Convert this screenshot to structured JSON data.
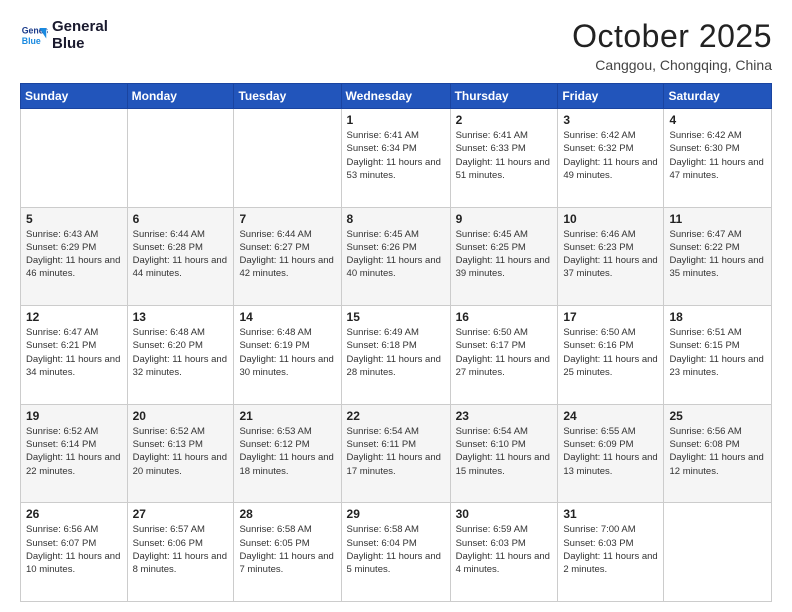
{
  "logo": {
    "line1": "General",
    "line2": "Blue"
  },
  "title": "October 2025",
  "subtitle": "Canggou, Chongqing, China",
  "days_of_week": [
    "Sunday",
    "Monday",
    "Tuesday",
    "Wednesday",
    "Thursday",
    "Friday",
    "Saturday"
  ],
  "weeks": [
    [
      {
        "day": "",
        "info": ""
      },
      {
        "day": "",
        "info": ""
      },
      {
        "day": "",
        "info": ""
      },
      {
        "day": "1",
        "info": "Sunrise: 6:41 AM\nSunset: 6:34 PM\nDaylight: 11 hours and 53 minutes."
      },
      {
        "day": "2",
        "info": "Sunrise: 6:41 AM\nSunset: 6:33 PM\nDaylight: 11 hours and 51 minutes."
      },
      {
        "day": "3",
        "info": "Sunrise: 6:42 AM\nSunset: 6:32 PM\nDaylight: 11 hours and 49 minutes."
      },
      {
        "day": "4",
        "info": "Sunrise: 6:42 AM\nSunset: 6:30 PM\nDaylight: 11 hours and 47 minutes."
      }
    ],
    [
      {
        "day": "5",
        "info": "Sunrise: 6:43 AM\nSunset: 6:29 PM\nDaylight: 11 hours and 46 minutes."
      },
      {
        "day": "6",
        "info": "Sunrise: 6:44 AM\nSunset: 6:28 PM\nDaylight: 11 hours and 44 minutes."
      },
      {
        "day": "7",
        "info": "Sunrise: 6:44 AM\nSunset: 6:27 PM\nDaylight: 11 hours and 42 minutes."
      },
      {
        "day": "8",
        "info": "Sunrise: 6:45 AM\nSunset: 6:26 PM\nDaylight: 11 hours and 40 minutes."
      },
      {
        "day": "9",
        "info": "Sunrise: 6:45 AM\nSunset: 6:25 PM\nDaylight: 11 hours and 39 minutes."
      },
      {
        "day": "10",
        "info": "Sunrise: 6:46 AM\nSunset: 6:23 PM\nDaylight: 11 hours and 37 minutes."
      },
      {
        "day": "11",
        "info": "Sunrise: 6:47 AM\nSunset: 6:22 PM\nDaylight: 11 hours and 35 minutes."
      }
    ],
    [
      {
        "day": "12",
        "info": "Sunrise: 6:47 AM\nSunset: 6:21 PM\nDaylight: 11 hours and 34 minutes."
      },
      {
        "day": "13",
        "info": "Sunrise: 6:48 AM\nSunset: 6:20 PM\nDaylight: 11 hours and 32 minutes."
      },
      {
        "day": "14",
        "info": "Sunrise: 6:48 AM\nSunset: 6:19 PM\nDaylight: 11 hours and 30 minutes."
      },
      {
        "day": "15",
        "info": "Sunrise: 6:49 AM\nSunset: 6:18 PM\nDaylight: 11 hours and 28 minutes."
      },
      {
        "day": "16",
        "info": "Sunrise: 6:50 AM\nSunset: 6:17 PM\nDaylight: 11 hours and 27 minutes."
      },
      {
        "day": "17",
        "info": "Sunrise: 6:50 AM\nSunset: 6:16 PM\nDaylight: 11 hours and 25 minutes."
      },
      {
        "day": "18",
        "info": "Sunrise: 6:51 AM\nSunset: 6:15 PM\nDaylight: 11 hours and 23 minutes."
      }
    ],
    [
      {
        "day": "19",
        "info": "Sunrise: 6:52 AM\nSunset: 6:14 PM\nDaylight: 11 hours and 22 minutes."
      },
      {
        "day": "20",
        "info": "Sunrise: 6:52 AM\nSunset: 6:13 PM\nDaylight: 11 hours and 20 minutes."
      },
      {
        "day": "21",
        "info": "Sunrise: 6:53 AM\nSunset: 6:12 PM\nDaylight: 11 hours and 18 minutes."
      },
      {
        "day": "22",
        "info": "Sunrise: 6:54 AM\nSunset: 6:11 PM\nDaylight: 11 hours and 17 minutes."
      },
      {
        "day": "23",
        "info": "Sunrise: 6:54 AM\nSunset: 6:10 PM\nDaylight: 11 hours and 15 minutes."
      },
      {
        "day": "24",
        "info": "Sunrise: 6:55 AM\nSunset: 6:09 PM\nDaylight: 11 hours and 13 minutes."
      },
      {
        "day": "25",
        "info": "Sunrise: 6:56 AM\nSunset: 6:08 PM\nDaylight: 11 hours and 12 minutes."
      }
    ],
    [
      {
        "day": "26",
        "info": "Sunrise: 6:56 AM\nSunset: 6:07 PM\nDaylight: 11 hours and 10 minutes."
      },
      {
        "day": "27",
        "info": "Sunrise: 6:57 AM\nSunset: 6:06 PM\nDaylight: 11 hours and 8 minutes."
      },
      {
        "day": "28",
        "info": "Sunrise: 6:58 AM\nSunset: 6:05 PM\nDaylight: 11 hours and 7 minutes."
      },
      {
        "day": "29",
        "info": "Sunrise: 6:58 AM\nSunset: 6:04 PM\nDaylight: 11 hours and 5 minutes."
      },
      {
        "day": "30",
        "info": "Sunrise: 6:59 AM\nSunset: 6:03 PM\nDaylight: 11 hours and 4 minutes."
      },
      {
        "day": "31",
        "info": "Sunrise: 7:00 AM\nSunset: 6:03 PM\nDaylight: 11 hours and 2 minutes."
      },
      {
        "day": "",
        "info": ""
      }
    ]
  ]
}
